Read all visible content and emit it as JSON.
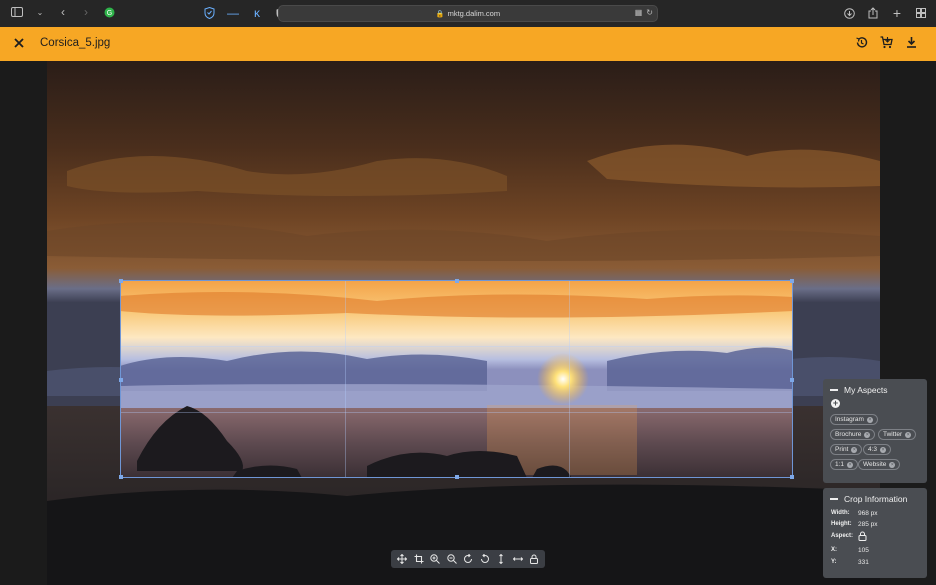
{
  "browser": {
    "url": "mktg.dalim.com"
  },
  "header": {
    "file_name": "Corsica_5.jpg",
    "icons": [
      "close-icon",
      "history-icon",
      "cart-icon",
      "download-icon"
    ]
  },
  "toolbar": {
    "tools": [
      "move-icon",
      "crop-icon",
      "zoom-in-icon",
      "zoom-out-icon",
      "rotate-left-icon",
      "rotate-right-icon",
      "flip-vertical-icon",
      "flip-horizontal-icon",
      "lock-icon"
    ]
  },
  "aspects_panel": {
    "title": "My Aspects",
    "chips": [
      {
        "label": "Instagram"
      },
      {
        "label": "Brochure"
      },
      {
        "label": "Twitter"
      },
      {
        "label": "Print"
      },
      {
        "label": "4:3"
      },
      {
        "label": "1:1"
      },
      {
        "label": "Website"
      }
    ]
  },
  "crop_panel": {
    "title": "Crop Information",
    "width_label": "Width:",
    "width_value": "968 px",
    "height_label": "Height:",
    "height_value": "285 px",
    "aspect_label": "Aspect:",
    "x_label": "X:",
    "x_value": "105",
    "y_label": "Y:",
    "y_value": "331"
  },
  "colors": {
    "header": "#f7a724",
    "crop_border": "#6f96d6",
    "panel": "#4a4d52"
  }
}
